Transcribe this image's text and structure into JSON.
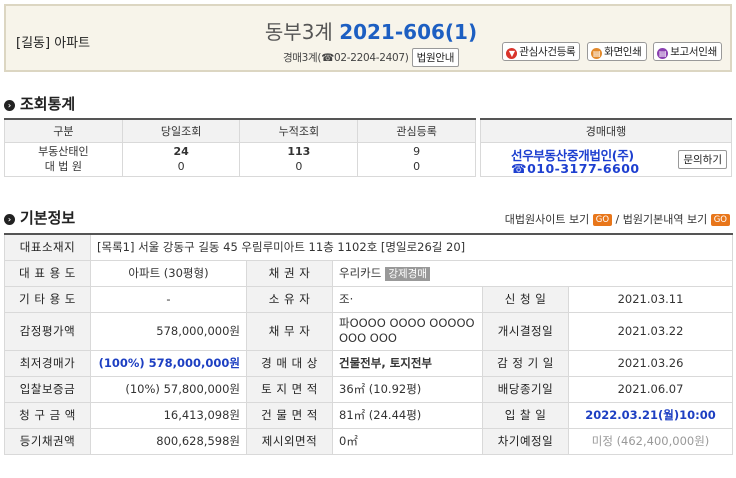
{
  "header": {
    "category": "[길동] 아파트",
    "court_name": "동부3계",
    "case_number": "2021-606(1)",
    "contact": "경매3계(☎02-2204-2407)",
    "court_info_button": "법원안내",
    "buttons": {
      "interest": "관심사건등록",
      "print": "화면인쇄",
      "report": "보고서인쇄"
    }
  },
  "stats_section": {
    "title": "조회통계",
    "headers": [
      "구분",
      "당일조회",
      "누적조회",
      "관심등록"
    ],
    "rows": [
      {
        "label1": "부동산태인",
        "label2": "대 법 원",
        "today1": "24",
        "today2": "0",
        "total1": "113",
        "total2": "0",
        "interest1": "9",
        "interest2": "0"
      }
    ],
    "agent_header": "경매대행",
    "agent_name": "선우부동산중개법인(주)",
    "agent_phone": "☎010-3177-6600",
    "inquiry_button": "문의하기"
  },
  "basic_section": {
    "title": "기본정보",
    "link1": "대법원사이트 보기",
    "link_sep": " / ",
    "link2": "법원기본내역 보기",
    "go": "GO"
  },
  "info": {
    "address_label": "대표소재지",
    "address_value": "[목록1] 서울 강동구 길동 45 우림루미아트 11층 1102호 [명일로26길 20]",
    "rows": [
      {
        "l1": "대 표 용 도",
        "v1": "아파트 (30평형)",
        "l2": "채 권 자",
        "v2": "우리카드",
        "tag": "강제경매"
      },
      {
        "l1": "기 타 용 도",
        "v1": "-",
        "l2": "소 유 자",
        "v2": "조·",
        "l3": "신 청 일",
        "v3": "2021.03.11"
      },
      {
        "l1": "감정평가액",
        "v1": "578,000,000원",
        "l2": "채 무 자",
        "v2a": "파OOOO OOOO OOOOO",
        "v2b": "OOO OOO",
        "l3": "개시결정일",
        "v3": "2021.03.22"
      },
      {
        "l1": "최저경매가",
        "v1": "(100%) 578,000,000원",
        "l2": "경 매 대 상",
        "v2": "건물전부, 토지전부",
        "l3": "감 정 기 일",
        "v3": "2021.03.26"
      },
      {
        "l1": "입찰보증금",
        "v1": "(10%) 57,800,000원",
        "l2": "토 지 면 적",
        "v2": "36㎡ (10.92평)",
        "l3": "배당종기일",
        "v3": "2021.06.07"
      },
      {
        "l1": "청 구 금 액",
        "v1": "16,413,098원",
        "l2": "건 물 면 적",
        "v2": "81㎡ (24.44평)",
        "l3": "입 찰 일",
        "v3": "2022.03.21(월)10:00"
      },
      {
        "l1": "등기채권액",
        "v1": "800,628,598원",
        "l2": "제시외면적",
        "v2": "0㎡",
        "l3": "차기예정일",
        "v3": "미정 (462,400,000원)"
      }
    ]
  }
}
